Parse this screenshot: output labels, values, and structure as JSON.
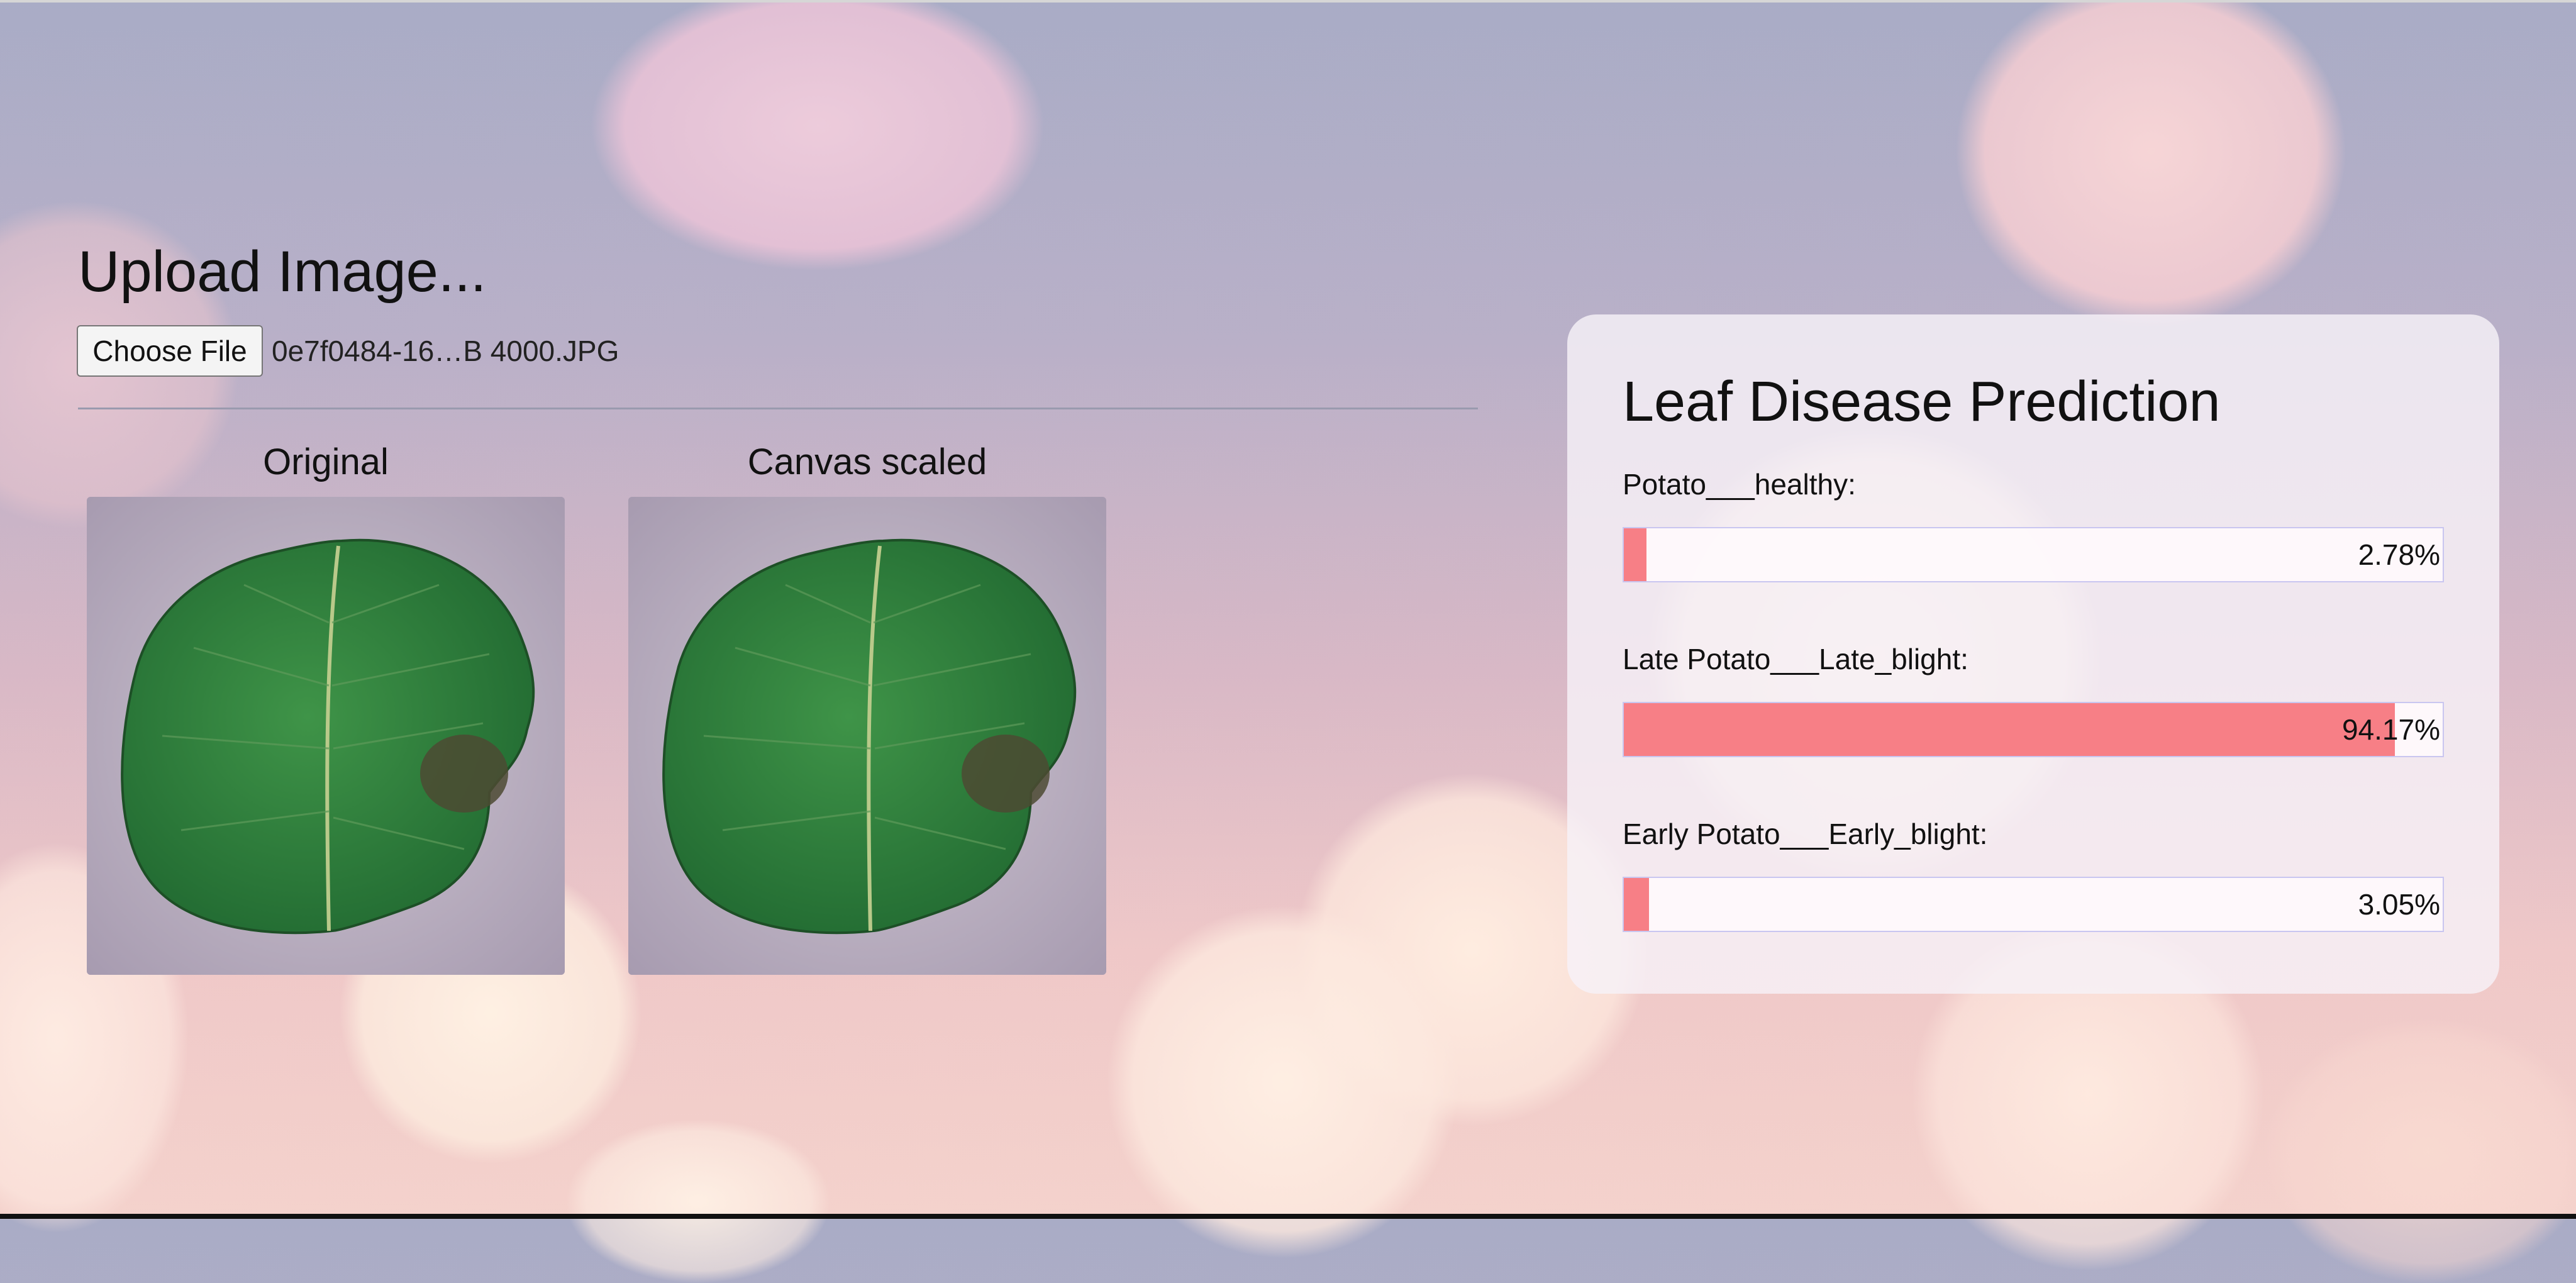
{
  "upload": {
    "title": "Upload Image...",
    "choose_file_label": "Choose File",
    "file_name": "0e7f0484-16…B 4000.JPG"
  },
  "images": {
    "original_caption": "Original",
    "scaled_caption": "Canvas scaled"
  },
  "panel": {
    "title": "Leaf Disease Prediction",
    "predictions": [
      {
        "label": "Potato___healthy:",
        "value_text": "2.78%",
        "value": 2.78
      },
      {
        "label": "Late Potato___Late_blight:",
        "value_text": "94.17%",
        "value": 94.17
      },
      {
        "label": "Early Potato___Early_blight:",
        "value_text": "3.05%",
        "value": 3.05
      }
    ]
  },
  "colors": {
    "bar_fill": "#f77f86",
    "bar_border": "#c9c6f0",
    "leaf": "#2f7d3c"
  }
}
